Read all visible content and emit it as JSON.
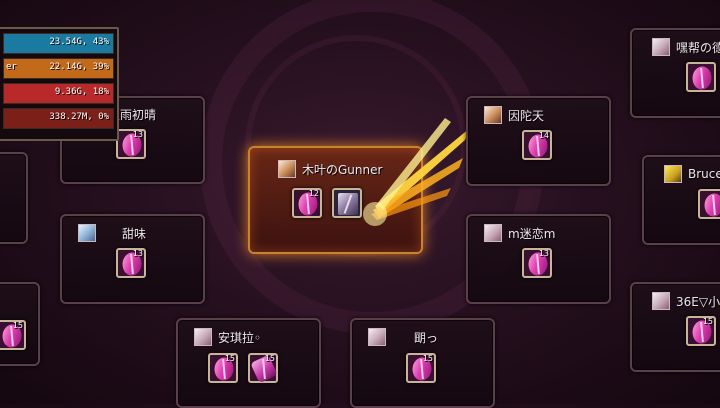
{
  "stats": [
    {
      "label": "",
      "value": "23.54G, 43%",
      "color": "#1a7aa0"
    },
    {
      "label": "er",
      "value": "22.14G, 39%",
      "color": "#c26a1a"
    },
    {
      "label": "",
      "value": "9.36G, 18%",
      "color": "#b82a2a"
    },
    {
      "label": "",
      "value": "338.27M, 0%",
      "color": "#7a2018"
    }
  ],
  "players": [
    {
      "name": "夏雨初晴",
      "slots": [
        "13"
      ]
    },
    {
      "name": "甜味",
      "slots": [
        "13"
      ]
    },
    {
      "name": "安琪拉◦",
      "slots": [
        "15",
        "15"
      ]
    },
    {
      "name": "木叶のGunner",
      "slots": [
        "12",
        ""
      ]
    },
    {
      "name": "朙っ",
      "slots": [
        "15"
      ]
    },
    {
      "name": "因陀天",
      "slots": [
        "14"
      ]
    },
    {
      "name": "m迷恋m",
      "slots": [
        "13"
      ]
    },
    {
      "name": "嘿帮の德",
      "slots": [
        ""
      ]
    },
    {
      "name": "Bruce",
      "slots": [
        ""
      ]
    },
    {
      "name": "36E▽小",
      "slots": [
        "15"
      ]
    },
    {
      "name": "",
      "slots": [
        "15"
      ]
    }
  ]
}
